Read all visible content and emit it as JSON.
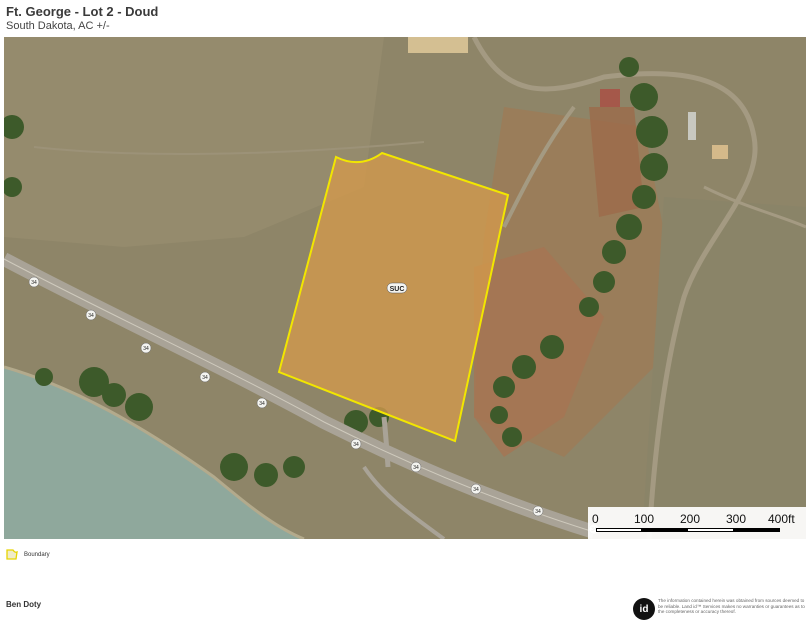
{
  "header": {
    "title": "Ft. George - Lot 2 - Doud",
    "subtitle": "South Dakota,  AC +/-"
  },
  "map": {
    "parcel_label": "SUC",
    "road_label": "34",
    "road_marker_count": 10,
    "scale": {
      "ticks": [
        "0",
        "100",
        "200",
        "300",
        "400ft"
      ]
    },
    "colors": {
      "boundary": "#f2e600",
      "parcel_fill": "#d39a4c",
      "land": "#8e8568",
      "water": "#8fa89c",
      "trees": "#3d5a2a",
      "road": "#a9a397"
    }
  },
  "legend": {
    "boundary_label": "Boundary"
  },
  "footer": {
    "name": "Ben Doty",
    "logo": "id",
    "disclaimer": "The information contained herein was obtained from sources deemed to be reliable. Land id™ Services makes no warranties or guarantees as to the completeness or accuracy thereof."
  }
}
